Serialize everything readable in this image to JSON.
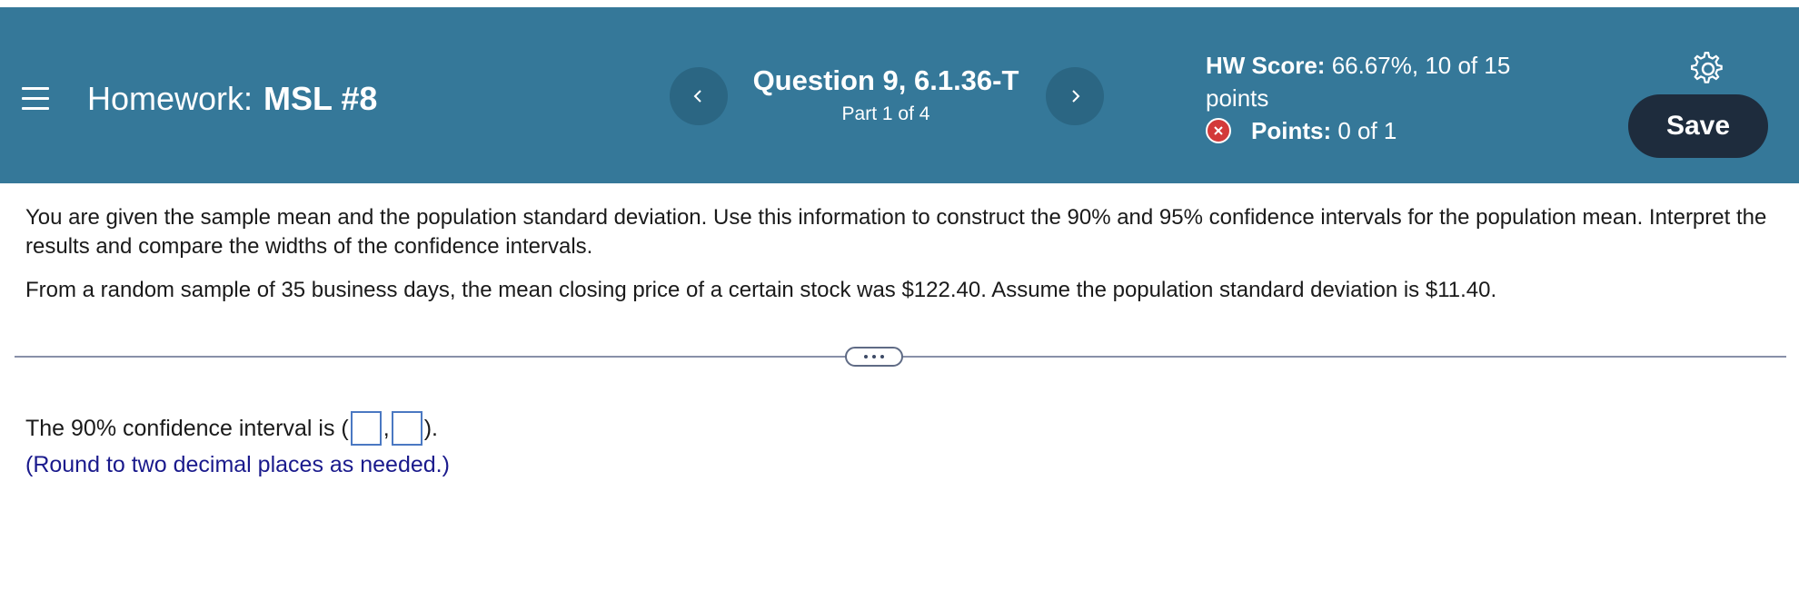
{
  "header": {
    "homework_label": "Homework:",
    "homework_name": "MSL #8",
    "question_title": "Question 9, 6.1.36-T",
    "question_part": "Part 1 of 4",
    "score_label": "HW Score:",
    "score_value": "66.67%, 10 of 15 points",
    "points_label": "Points:",
    "points_value": "0 of 1",
    "save_label": "Save",
    "icons": [
      "menu-icon",
      "chevron-left-icon",
      "chevron-right-icon",
      "incorrect-x-icon",
      "gear-icon"
    ],
    "colors": {
      "bar": "#357899",
      "save": "#1e2c3d",
      "incorrect": "#d33a3a"
    }
  },
  "problem": {
    "instructions": "You are given the sample mean and the population standard deviation. Use this information to construct the 90% and 95% confidence intervals for the population mean. Interpret the results and compare the widths of the confidence intervals.",
    "given": "From a random sample of 35 business days, the mean closing price of a certain stock was $122.40. Assume the population standard deviation is $11.40."
  },
  "answer": {
    "prefix": "The 90% confidence interval is (",
    "separator": ",",
    "suffix": ").",
    "input1_value": "",
    "input2_value": "",
    "hint": "(Round to two decimal places as needed.)"
  }
}
